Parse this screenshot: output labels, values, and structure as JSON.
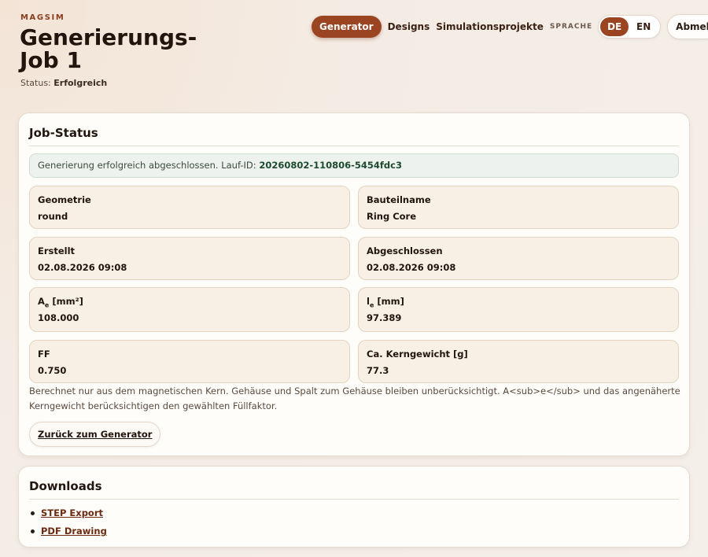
{
  "header": {
    "brand": "MAGSIM",
    "title": "Generierungs-Job 1",
    "status_label": "Status:",
    "status_value": "Erfolgreich"
  },
  "nav": {
    "generator": "Generator",
    "designs": "Designs",
    "projects": "Simulationsprojekte",
    "language_label": "SPRACHE",
    "lang_de": "DE",
    "lang_en": "EN",
    "logout": "Abmelden"
  },
  "job_status": {
    "heading": "Job-Status",
    "success_text": "Generierung erfolgreich abgeschlossen. Lauf-ID:",
    "run_id": "20260802-110806-5454fdc3",
    "fields": [
      {
        "label": "Geometrie",
        "value": "round"
      },
      {
        "label": "Bauteilname",
        "value": "Ring Core"
      },
      {
        "label": "Erstellt",
        "value": "02.08.2026 09:08"
      },
      {
        "label": "Abgeschlossen",
        "value": "02.08.2026 09:08"
      },
      {
        "label_main": "A",
        "label_sub": "e",
        "label_unit": "[mm²]",
        "value": "108.000"
      },
      {
        "label_main": "l",
        "label_sub": "e",
        "label_unit": "[mm]",
        "value": "97.389"
      },
      {
        "label": "FF",
        "value": "0.750"
      },
      {
        "label": "Ca. Kerngewicht [g]",
        "value": "77.3"
      }
    ],
    "note": "Berechnet nur aus dem magnetischen Kern. Gehäuse und Spalt zum Gehäuse bleiben unberücksichtigt. A<sub>e</sub> und das angenäherte Kerngewicht berücksichtigen den gewählten Füllfaktor.",
    "back_button": "Zurück zum Generator"
  },
  "downloads": {
    "heading": "Downloads",
    "items": [
      {
        "label": "STEP Export"
      },
      {
        "label": "PDF Drawing"
      }
    ]
  },
  "colors": {
    "accent": "#9a4421",
    "success_bg": "#eef2ee",
    "field_bg": "#f8efe5"
  }
}
